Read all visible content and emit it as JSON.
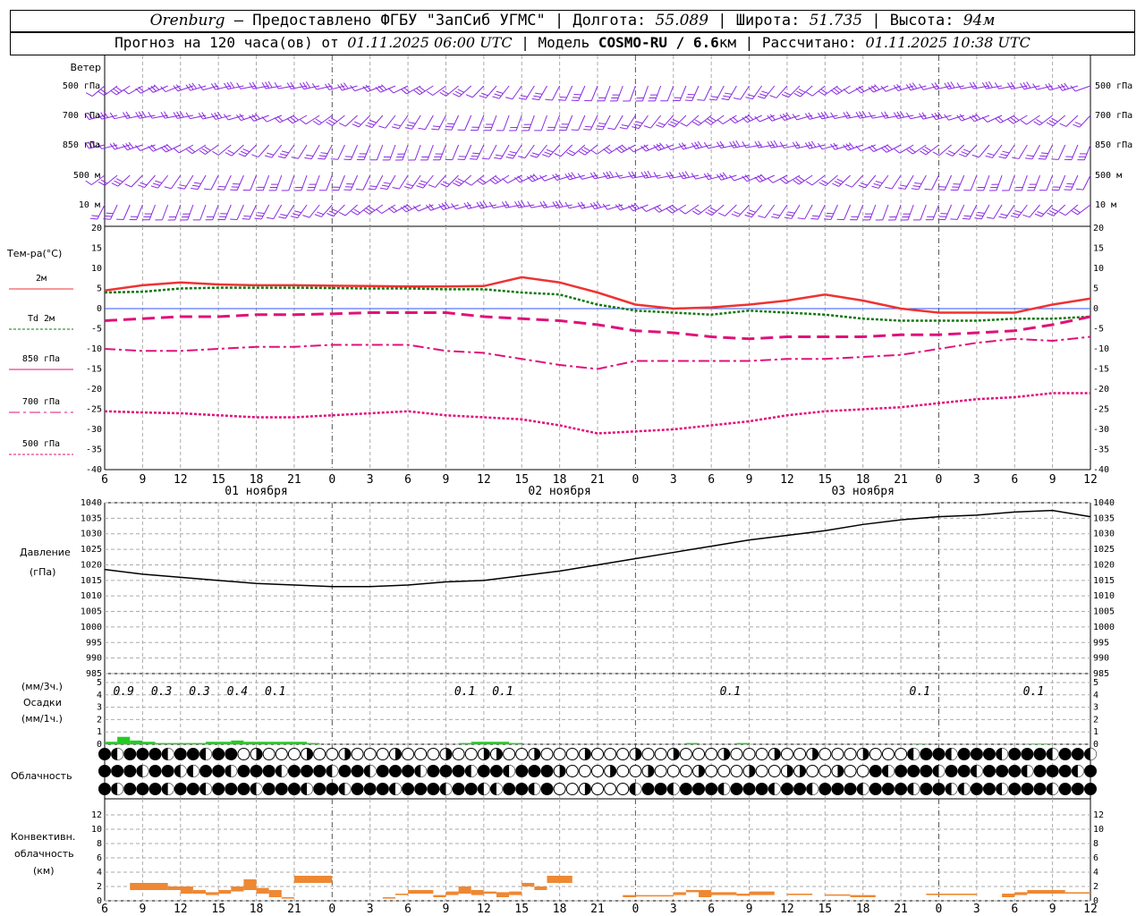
{
  "header": {
    "line1": {
      "city": "Orenburg",
      "provider": " — Предоставлено ФГБУ \"ЗапСиб УГМС\" | Долгота: ",
      "lon": "55.089",
      "lat_label": " | Широта: ",
      "lat": "51.735",
      "alt_label": " | Высота: ",
      "alt": "94м"
    },
    "line2": {
      "prefix": "Прогноз на 120 часа(ов) от ",
      "date": "01.11.2025 06:00 UTC",
      "model_label": " | Модель ",
      "model": "COSMO-RU / 6.6",
      "km": "км",
      "calc_label": " | Рассчитано: ",
      "calc": "01.11.2025 10:38 UTC"
    }
  },
  "time_axis": {
    "ticks": [
      "6",
      "9",
      "12",
      "15",
      "18",
      "21",
      "0",
      "3",
      "6",
      "9",
      "12",
      "15",
      "18",
      "21",
      "0",
      "3",
      "6",
      "9",
      "12",
      "15",
      "18",
      "21",
      "0",
      "3",
      "6",
      "9",
      "12"
    ],
    "days": [
      "01 ноября",
      "02 ноября",
      "03 ноября"
    ]
  },
  "wind_panel": {
    "title": "Ветер",
    "levels": [
      "500 гПа",
      "700 гПа",
      "850 гПа",
      "500 м",
      "10 м"
    ],
    "color": "#8a2be2"
  },
  "temp_panel": {
    "title": "Тем-ра(°C)",
    "legend": [
      {
        "label": "2м",
        "color": "#ee3333"
      },
      {
        "label": "Td 2м",
        "color": "#117711"
      },
      {
        "label": "850 гПа",
        "color": "#e0117a"
      },
      {
        "label": "700 гПа",
        "color": "#e0117a"
      },
      {
        "label": "500 гПа",
        "color": "#e0117a"
      }
    ],
    "yticks": [
      "20",
      "15",
      "10",
      "5",
      "0",
      "-5",
      "-10",
      "-15",
      "-20",
      "-25",
      "-30",
      "-35",
      "-40"
    ]
  },
  "pressure_panel": {
    "title": "Давление",
    "unit": "(гПа)",
    "yticks": [
      "1040",
      "1035",
      "1030",
      "1025",
      "1020",
      "1015",
      "1010",
      "1005",
      "1000",
      "995",
      "990",
      "985"
    ]
  },
  "precip_panel": {
    "unit3": "(мм/3ч.)",
    "title": "Осадки",
    "unit1": "(мм/1ч.)",
    "yticks": [
      "5",
      "4",
      "3",
      "2",
      "1",
      "0"
    ],
    "totals": [
      {
        "h": 1.5,
        "v": "0.9"
      },
      {
        "h": 4.5,
        "v": "0.3"
      },
      {
        "h": 7.5,
        "v": "0.3"
      },
      {
        "h": 10.5,
        "v": "0.4"
      },
      {
        "h": 13.5,
        "v": "0.1"
      },
      {
        "h": 28.5,
        "v": "0.1"
      },
      {
        "h": 31.5,
        "v": "0.1"
      },
      {
        "h": 49.5,
        "v": "0.1"
      },
      {
        "h": 64.5,
        "v": "0.1"
      },
      {
        "h": 73.5,
        "v": "0.1"
      }
    ],
    "color": "#22cc22"
  },
  "cloud_panel": {
    "title": "Облачность"
  },
  "conv_panel": {
    "title1": "Конвективн.",
    "title2": "облачность",
    "unit": "(км)",
    "yticks": [
      "12",
      "10",
      "8",
      "6",
      "4",
      "2",
      "0"
    ],
    "color": "#ee8833"
  },
  "chart_data": [
    {
      "type": "line",
      "title": "Тем-ра(°C)",
      "x_unit": "hours from 01.11.2025 06:00 UTC",
      "ylim": [
        -40,
        20
      ],
      "series": [
        {
          "name": "2м",
          "x": [
            0,
            3,
            6,
            9,
            12,
            15,
            18,
            21,
            24,
            27,
            30,
            33,
            36,
            39,
            42,
            45,
            48,
            51,
            54,
            57,
            60,
            63,
            66,
            69,
            72,
            75,
            78
          ],
          "values": [
            4.5,
            5.8,
            6.5,
            6.0,
            5.8,
            5.8,
            5.7,
            5.6,
            5.5,
            5.5,
            5.6,
            7.8,
            6.5,
            4.0,
            1.0,
            0.0,
            0.3,
            1.0,
            2.0,
            3.5,
            2.0,
            0.0,
            -1.0,
            -1.0,
            -1.0,
            1.0,
            2.5
          ]
        },
        {
          "name": "Td 2м",
          "x": [
            0,
            3,
            6,
            9,
            12,
            15,
            18,
            21,
            24,
            27,
            30,
            33,
            36,
            39,
            42,
            45,
            48,
            51,
            54,
            57,
            60,
            63,
            66,
            69,
            72,
            75,
            78
          ],
          "values": [
            4.0,
            4.2,
            5.0,
            5.2,
            5.2,
            5.2,
            5.1,
            5.0,
            5.0,
            4.8,
            4.8,
            4.0,
            3.5,
            1.0,
            -0.5,
            -1.0,
            -1.5,
            -0.5,
            -1.0,
            -1.5,
            -2.5,
            -3.0,
            -3.0,
            -3.0,
            -2.5,
            -2.5,
            -2.0
          ]
        },
        {
          "name": "850 гПа",
          "x": [
            0,
            3,
            6,
            9,
            12,
            15,
            18,
            21,
            24,
            27,
            30,
            33,
            36,
            39,
            42,
            45,
            48,
            51,
            54,
            57,
            60,
            63,
            66,
            69,
            72,
            75,
            78
          ],
          "values": [
            -3.0,
            -2.5,
            -2.0,
            -2.0,
            -1.5,
            -1.5,
            -1.3,
            -1.0,
            -1.0,
            -1.0,
            -2.0,
            -2.5,
            -3.0,
            -4.0,
            -5.5,
            -6.0,
            -7.0,
            -7.5,
            -7.0,
            -7.0,
            -7.0,
            -6.5,
            -6.5,
            -6.0,
            -5.5,
            -4.0,
            -2.0
          ]
        },
        {
          "name": "700 гПа",
          "x": [
            0,
            3,
            6,
            9,
            12,
            15,
            18,
            21,
            24,
            27,
            30,
            33,
            36,
            39,
            42,
            45,
            48,
            51,
            54,
            57,
            60,
            63,
            66,
            69,
            72,
            75,
            78
          ],
          "values": [
            -10.0,
            -10.5,
            -10.5,
            -10.0,
            -9.5,
            -9.5,
            -9.0,
            -9.0,
            -9.0,
            -10.5,
            -11.0,
            -12.5,
            -14.0,
            -15.0,
            -13.0,
            -13.0,
            -13.0,
            -13.0,
            -12.5,
            -12.5,
            -12.0,
            -11.5,
            -10.0,
            -8.5,
            -7.5,
            -8.0,
            -7.0
          ]
        },
        {
          "name": "500 гПа",
          "x": [
            0,
            3,
            6,
            9,
            12,
            15,
            18,
            21,
            24,
            27,
            30,
            33,
            36,
            39,
            42,
            45,
            48,
            51,
            54,
            57,
            60,
            63,
            66,
            69,
            72,
            75,
            78
          ],
          "values": [
            -25.5,
            -25.8,
            -26.0,
            -26.5,
            -27.0,
            -27.0,
            -26.5,
            -26.0,
            -25.5,
            -26.5,
            -27.0,
            -27.5,
            -29.0,
            -31.0,
            -30.5,
            -30.0,
            -29.0,
            -28.0,
            -26.5,
            -25.5,
            -25.0,
            -24.5,
            -23.5,
            -22.5,
            -22.0,
            -21.0,
            -21.0
          ]
        }
      ]
    },
    {
      "type": "line",
      "title": "Давление",
      "ylabel": "(гПа)",
      "ylim": [
        985,
        1040
      ],
      "series": [
        {
          "x": [
            0,
            3,
            6,
            9,
            12,
            15,
            18,
            21,
            24,
            27,
            30,
            33,
            36,
            39,
            42,
            45,
            48,
            51,
            54,
            57,
            60,
            63,
            66,
            69,
            72,
            75,
            78
          ],
          "values": [
            1018.5,
            1017.0,
            1016.0,
            1015.0,
            1014.0,
            1013.5,
            1013.0,
            1013.0,
            1013.5,
            1014.5,
            1015.0,
            1016.5,
            1018.0,
            1020.0,
            1022.0,
            1024.0,
            1026.0,
            1028.0,
            1029.5,
            1031.0,
            1033.0,
            1034.5,
            1035.5,
            1036.0,
            1037.0,
            1037.5,
            1035.5
          ]
        }
      ]
    },
    {
      "type": "bar",
      "title": "Осадки",
      "ylabel": "(мм/1ч.)",
      "ylim": [
        0,
        5
      ],
      "x": [
        0,
        1,
        2,
        3,
        4,
        5,
        6,
        7,
        8,
        9,
        10,
        11,
        12,
        13,
        14,
        15,
        16,
        28,
        29,
        30,
        31,
        32,
        46,
        50,
        64,
        73,
        74
      ],
      "values": [
        0.2,
        0.6,
        0.3,
        0.2,
        0.1,
        0.1,
        0.1,
        0.1,
        0.2,
        0.2,
        0.3,
        0.2,
        0.2,
        0.2,
        0.2,
        0.2,
        0.1,
        0.1,
        0.2,
        0.2,
        0.2,
        0.1,
        0.1,
        0.1,
        0.05,
        0.05,
        0.05
      ]
    },
    {
      "type": "bar",
      "title": "Конвективн. облачность",
      "ylabel": "(км)",
      "ylim": [
        0,
        13
      ],
      "segments": [
        [
          0,
          1,
          0.5,
          0.5
        ],
        [
          1,
          2,
          1.0,
          0.5
        ],
        [
          2,
          5,
          1.5,
          2.5
        ],
        [
          5,
          6,
          1.5,
          2.0
        ],
        [
          6,
          7,
          1.0,
          2.0
        ],
        [
          7,
          8,
          1.0,
          1.5
        ],
        [
          8,
          9,
          0.8,
          1.2
        ],
        [
          9,
          10,
          1.0,
          1.5
        ],
        [
          10,
          11,
          1.3,
          2.0
        ],
        [
          11,
          12,
          1.5,
          3.0
        ],
        [
          12,
          13,
          1.0,
          1.8
        ],
        [
          13,
          14,
          0.5,
          1.5
        ],
        [
          14,
          15,
          0.3,
          0.5
        ],
        [
          15,
          18,
          2.5,
          3.5
        ],
        [
          22,
          23,
          0.3,
          0.5
        ],
        [
          23,
          24,
          0.8,
          1.0
        ],
        [
          24,
          26,
          1.0,
          1.5
        ],
        [
          26,
          27,
          0.5,
          0.8
        ],
        [
          27,
          28,
          0.8,
          1.3
        ],
        [
          28,
          29,
          1.0,
          2.0
        ],
        [
          29,
          30,
          0.8,
          1.5
        ],
        [
          30,
          31,
          1.0,
          1.3
        ],
        [
          31,
          32,
          0.5,
          1.2
        ],
        [
          32,
          33,
          0.8,
          1.3
        ],
        [
          33,
          34,
          2.0,
          2.5
        ],
        [
          34,
          35,
          1.5,
          2.0
        ],
        [
          35,
          37,
          2.5,
          3.5
        ],
        [
          41,
          42,
          0.5,
          0.8
        ],
        [
          42,
          45,
          0.6,
          0.8
        ],
        [
          45,
          46,
          0.8,
          1.2
        ],
        [
          46,
          47,
          1.2,
          1.5
        ],
        [
          47,
          48,
          0.5,
          1.5
        ],
        [
          48,
          50,
          0.8,
          1.2
        ],
        [
          50,
          51,
          0.7,
          1.0
        ],
        [
          51,
          53,
          0.8,
          1.3
        ],
        [
          54,
          56,
          0.8,
          1.0
        ],
        [
          57,
          59,
          0.7,
          0.9
        ],
        [
          59,
          61,
          0.5,
          0.8
        ],
        [
          65,
          69,
          0.8,
          1.0
        ],
        [
          71,
          72,
          0.5,
          1.0
        ],
        [
          72,
          73,
          0.8,
          1.2
        ],
        [
          73,
          76,
          1.0,
          1.5
        ],
        [
          76,
          78,
          1.0,
          1.2
        ]
      ]
    }
  ]
}
